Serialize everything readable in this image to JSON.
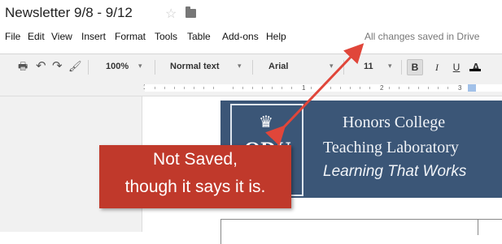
{
  "title_bar": {
    "doc_title": "Newsletter 9/8 - 9/12",
    "star_glyph": "☆"
  },
  "menu": {
    "items": [
      "File",
      "Edit",
      "View",
      "Insert",
      "Format",
      "Tools",
      "Table",
      "Add-ons",
      "Help"
    ],
    "save_status": "All changes saved in Drive"
  },
  "toolbar": {
    "print_glyph": "🖶",
    "undo_glyph": "↶",
    "redo_glyph": "↷",
    "paint_glyph": "🖌",
    "zoom": "100%",
    "style": "Normal text",
    "font": "Arial",
    "font_size": "11",
    "bold": "B",
    "italic": "I",
    "underline": "U",
    "text_color": "A"
  },
  "ruler": {
    "numbers": [
      "1",
      "1",
      "2",
      "3"
    ]
  },
  "banner": {
    "seal_text": "ODU",
    "line1": "Honors College",
    "line2": "Teaching Laboratory",
    "line3": "Learning That Works"
  },
  "annotation": {
    "line1": "Not Saved,",
    "line2": "though it says it is.",
    "color": "#c0392b"
  }
}
